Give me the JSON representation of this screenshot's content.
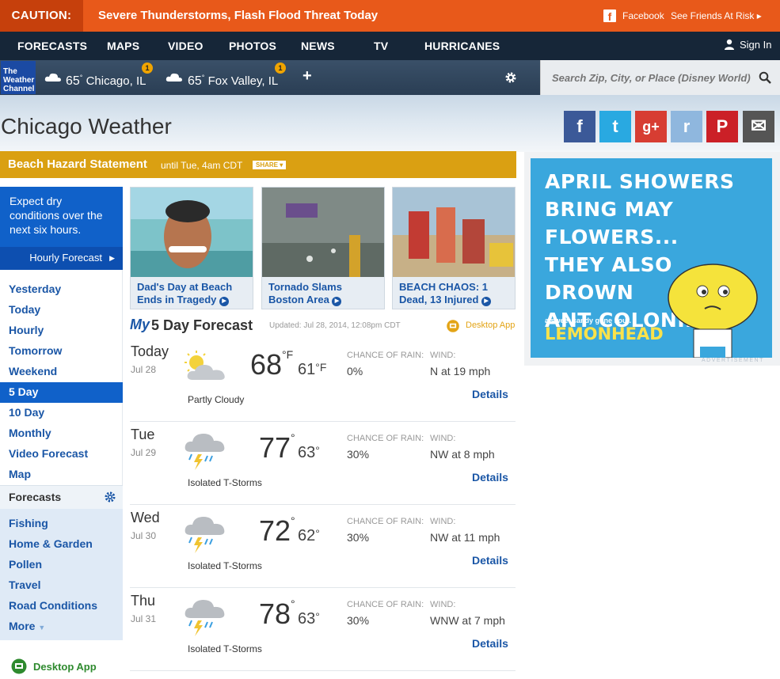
{
  "caution": {
    "label": "CAUTION:",
    "message": "Severe Thunderstorms, Flash Flood Threat Today",
    "facebook": "Facebook",
    "friends": "See Friends At Risk ▸"
  },
  "nav": {
    "items": [
      "FORECASTS",
      "MAPS",
      "VIDEO",
      "PHOTOS",
      "NEWS",
      "TV",
      "HURRICANES"
    ],
    "signin": "Sign In"
  },
  "logo": {
    "text": "The Weather Channel"
  },
  "locations": [
    {
      "temp": "65",
      "deg": "°",
      "name": "Chicago, IL",
      "alerts": "1"
    },
    {
      "temp": "65",
      "deg": "°",
      "name": "Fox Valley, IL",
      "alerts": "1"
    }
  ],
  "add_label": "+",
  "search": {
    "placeholder": "Search Zip, City, or Place (Disney World)"
  },
  "page_title": "Chicago Weather",
  "social": [
    {
      "icon": "facebook-icon",
      "glyph": "f",
      "color": "#3b5998"
    },
    {
      "icon": "twitter-icon",
      "glyph": "t",
      "color": "#29a9e1"
    },
    {
      "icon": "googleplus-icon",
      "glyph": "g+",
      "color": "#d73d32"
    },
    {
      "icon": "reddit-icon",
      "glyph": "r",
      "color": "#8fb7de"
    },
    {
      "icon": "pinterest-icon",
      "glyph": "P",
      "color": "#cb2027"
    },
    {
      "icon": "email-icon",
      "glyph": "✉",
      "color": "#555555"
    }
  ],
  "hazard": {
    "title": "Beach Hazard Statement",
    "until": "until Tue, 4am CDT",
    "share": "SHARE ▾"
  },
  "sidebar": {
    "expect": "Expect dry conditions over the next six hours.",
    "hourly": "Hourly Forecast",
    "items": [
      "Yesterday",
      "Today",
      "Hourly",
      "Tomorrow",
      "Weekend",
      "5 Day",
      "10 Day",
      "Monthly",
      "Video Forecast",
      "Map"
    ],
    "active": "5 Day",
    "forecasts_head": "Forecasts",
    "forecasts": [
      "Fishing",
      "Home & Garden",
      "Pollen",
      "Travel",
      "Road Conditions",
      "More"
    ],
    "desktop_app": "Desktop App"
  },
  "news": [
    {
      "caption": "Dad's Day at Beach Ends in Tragedy"
    },
    {
      "caption": "Tornado Slams Boston Area"
    },
    {
      "caption": "BEACH CHAOS: 1 Dead, 13 Injured"
    }
  ],
  "forecast": {
    "my": "My",
    "title": "5 Day Forecast",
    "updated": "Updated: Jul 28, 2014, 12:08pm CDT",
    "desktop_app": "Desktop App",
    "rain_label": "CHANCE OF RAIN:",
    "wind_label": "WIND:",
    "details": "Details",
    "days": [
      {
        "day": "Today",
        "date": "Jul 28",
        "hi": "68",
        "lo": "61",
        "hi_unit": "°F",
        "lo_unit": "°F",
        "rain": "0%",
        "wind": "N at 19 mph",
        "condition": "Partly Cloudy",
        "icon": "partly-cloudy-icon"
      },
      {
        "day": "Tue",
        "date": "Jul 29",
        "hi": "77",
        "lo": "63",
        "hi_unit": "°",
        "lo_unit": "°",
        "rain": "30%",
        "wind": "NW at 8 mph",
        "condition": "Isolated T-Storms",
        "icon": "thunderstorm-icon"
      },
      {
        "day": "Wed",
        "date": "Jul 30",
        "hi": "72",
        "lo": "62",
        "hi_unit": "°",
        "lo_unit": "°",
        "rain": "30%",
        "wind": "NW at 11 mph",
        "condition": "Isolated T-Storms",
        "icon": "thunderstorm-icon"
      },
      {
        "day": "Thu",
        "date": "Jul 31",
        "hi": "78",
        "lo": "63",
        "hi_unit": "°",
        "lo_unit": "°",
        "rain": "30%",
        "wind": "WNW at 7 mph",
        "condition": "Isolated T-Storms",
        "icon": "thunderstorm-icon"
      }
    ]
  },
  "ad": {
    "lines": [
      "APRIL SHOWERS",
      "BRING MAY FLOWERS...",
      "THEY ALSO DROWN",
      "ANT COLONIES."
    ],
    "tagline": "a sweet candy gone sour.",
    "brand": "LEMONHEAD",
    "label": "ADVERTISEMENT"
  }
}
